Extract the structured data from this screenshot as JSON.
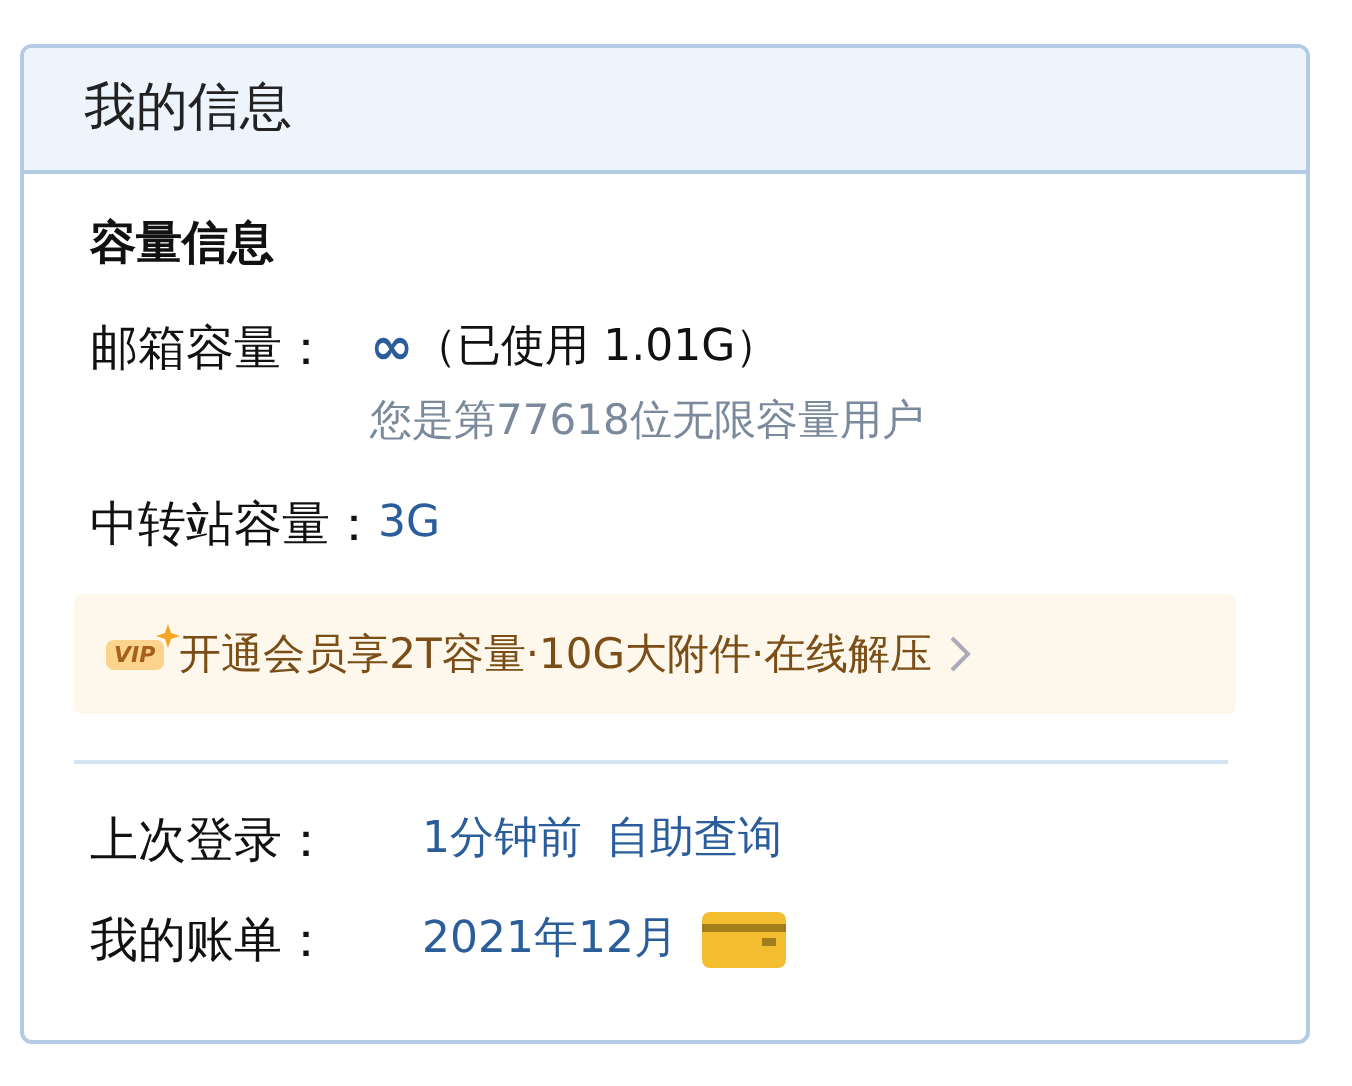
{
  "header": {
    "title": "我的信息"
  },
  "section_title": "容量信息",
  "mailbox": {
    "label": "邮箱容量：",
    "icon_text": "∞",
    "value": "（已使用 1.01G）",
    "note": "您是第77618位无限容量用户"
  },
  "transfer": {
    "label": "中转站容量：",
    "value": "3G"
  },
  "promo": {
    "badge": "VIP",
    "text": "开通会员享2T容量·10G大附件·在线解压"
  },
  "last_login": {
    "label": "上次登录：",
    "value": "1分钟前",
    "link": "自助查询"
  },
  "bill": {
    "label": "我的账单：",
    "value": "2021年12月"
  }
}
